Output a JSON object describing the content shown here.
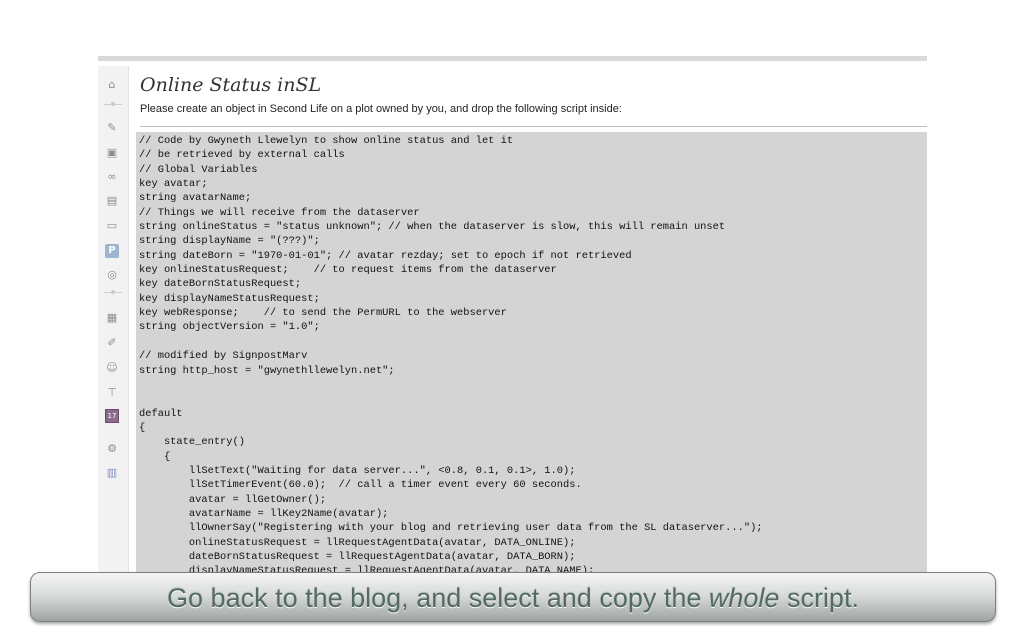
{
  "page": {
    "title": "Online Status inSL",
    "intro": "Please create an object in Second Life on a plot owned by you, and drop the following script inside:"
  },
  "sidebar": {
    "icons": [
      "home-icon",
      "pin-icon",
      "media-icon",
      "link-icon",
      "pages-icon",
      "comments-icon",
      "polldaddy-icon",
      "appearance-icon",
      "plugins-icon",
      "users-icon",
      "tools-icon",
      "calendar-icon",
      "settings-icon",
      "stats-icon"
    ]
  },
  "code": {
    "text": "// Code by Gwyneth Llewelyn to show online status and let it\n// be retrieved by external calls\n// Global Variables\nkey avatar;\nstring avatarName;\n// Things we will receive from the dataserver\nstring onlineStatus = \"status unknown\"; // when the dataserver is slow, this will remain unset\nstring displayName = \"(???)\";\nstring dateBorn = \"1970-01-01\"; // avatar rezday; set to epoch if not retrieved\nkey onlineStatusRequest;    // to request items from the dataserver\nkey dateBornStatusRequest;\nkey displayNameStatusRequest;\nkey webResponse;    // to send the PermURL to the webserver\nstring objectVersion = \"1.0\";\n\n// modified by SignpostMarv\nstring http_host = \"gwynethllewelyn.net\";\n\n\ndefault\n{\n    state_entry()\n    {\n        llSetText(\"Waiting for data server...\", <0.8, 0.1, 0.1>, 1.0);\n        llSetTimerEvent(60.0);  // call a timer event every 60 seconds.\n        avatar = llGetOwner();\n        avatarName = llKey2Name(avatar);\n        llOwnerSay(\"Registering with your blog and retrieving user data from the SL dataserver...\");\n        onlineStatusRequest = llRequestAgentData(avatar, DATA_ONLINE);\n        dateBornStatusRequest = llRequestAgentData(avatar, DATA_BORN);\n        displayNameStatusRequest = llRequestAgentData(avatar, DATA_NAME);"
  },
  "banner": {
    "before": "Go back to the blog, and select and copy the ",
    "emphasis": "whole",
    "after": " script."
  },
  "colors": {
    "code_background": "#d4d4d4",
    "banner_text": "#536b66"
  }
}
